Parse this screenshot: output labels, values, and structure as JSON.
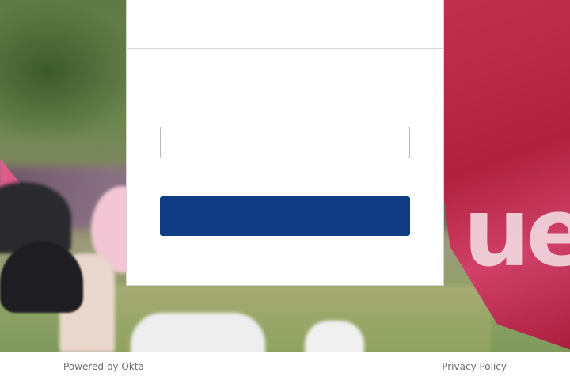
{
  "sign_in_card": {
    "title": "",
    "input_value": "",
    "input_placeholder": "",
    "submit_label": ""
  },
  "footer": {
    "powered_by": "Powered by Okta",
    "privacy": "Privacy Policy"
  },
  "colors": {
    "button": "#0f3b82",
    "card_bg": "#ffffff",
    "footer_text": "#6e6e6e"
  }
}
